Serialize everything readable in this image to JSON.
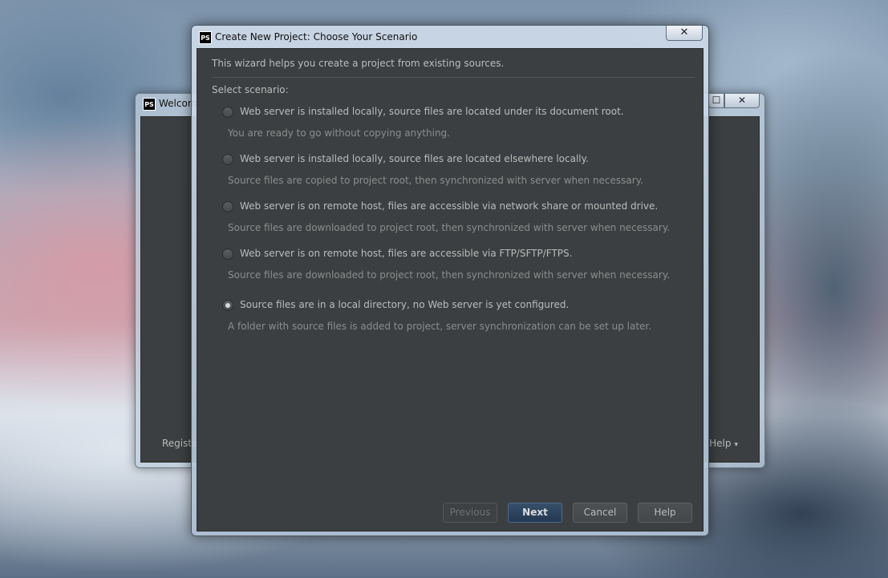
{
  "background_window": {
    "title": "Welcom",
    "register_label": "Registe",
    "help_label": "Help",
    "help_caret": "▾",
    "maximize_glyph": "☐",
    "close_glyph": "✕"
  },
  "dialog": {
    "title": "Create New Project: Choose Your Scenario",
    "logo_text": "PS",
    "close_glyph": "✕",
    "intro": "This wizard helps you create a project from existing sources.",
    "select_label": "Select scenario:",
    "options": [
      {
        "label": "Web server is installed locally, source files are located under its document root.",
        "description": "You are ready to go without copying anything.",
        "selected": false
      },
      {
        "label": "Web server is installed locally, source files are located elsewhere locally.",
        "description": "Source files are copied to project root, then synchronized with server when necessary.",
        "selected": false
      },
      {
        "label": "Web server is on remote host, files are accessible via network share or mounted drive.",
        "description": "Source files are downloaded to project root, then synchronized with server when necessary.",
        "selected": false
      },
      {
        "label": "Web server is on remote host, files are accessible via FTP/SFTP/FTPS.",
        "description": "Source files are downloaded to project root, then synchronized with server when necessary.",
        "selected": false
      },
      {
        "label": "Source files are in a local directory, no Web server is yet configured.",
        "description": "A folder with source files is added to project, server synchronization can be set up later.",
        "selected": true
      }
    ],
    "buttons": {
      "previous": "Previous",
      "next": "Next",
      "cancel": "Cancel",
      "help": "Help"
    }
  },
  "colors": {
    "dialog_background": "#3c3f41",
    "text_primary": "#bbbbbb",
    "text_secondary": "#8c8c8c",
    "primary_button": "#2d4461"
  }
}
